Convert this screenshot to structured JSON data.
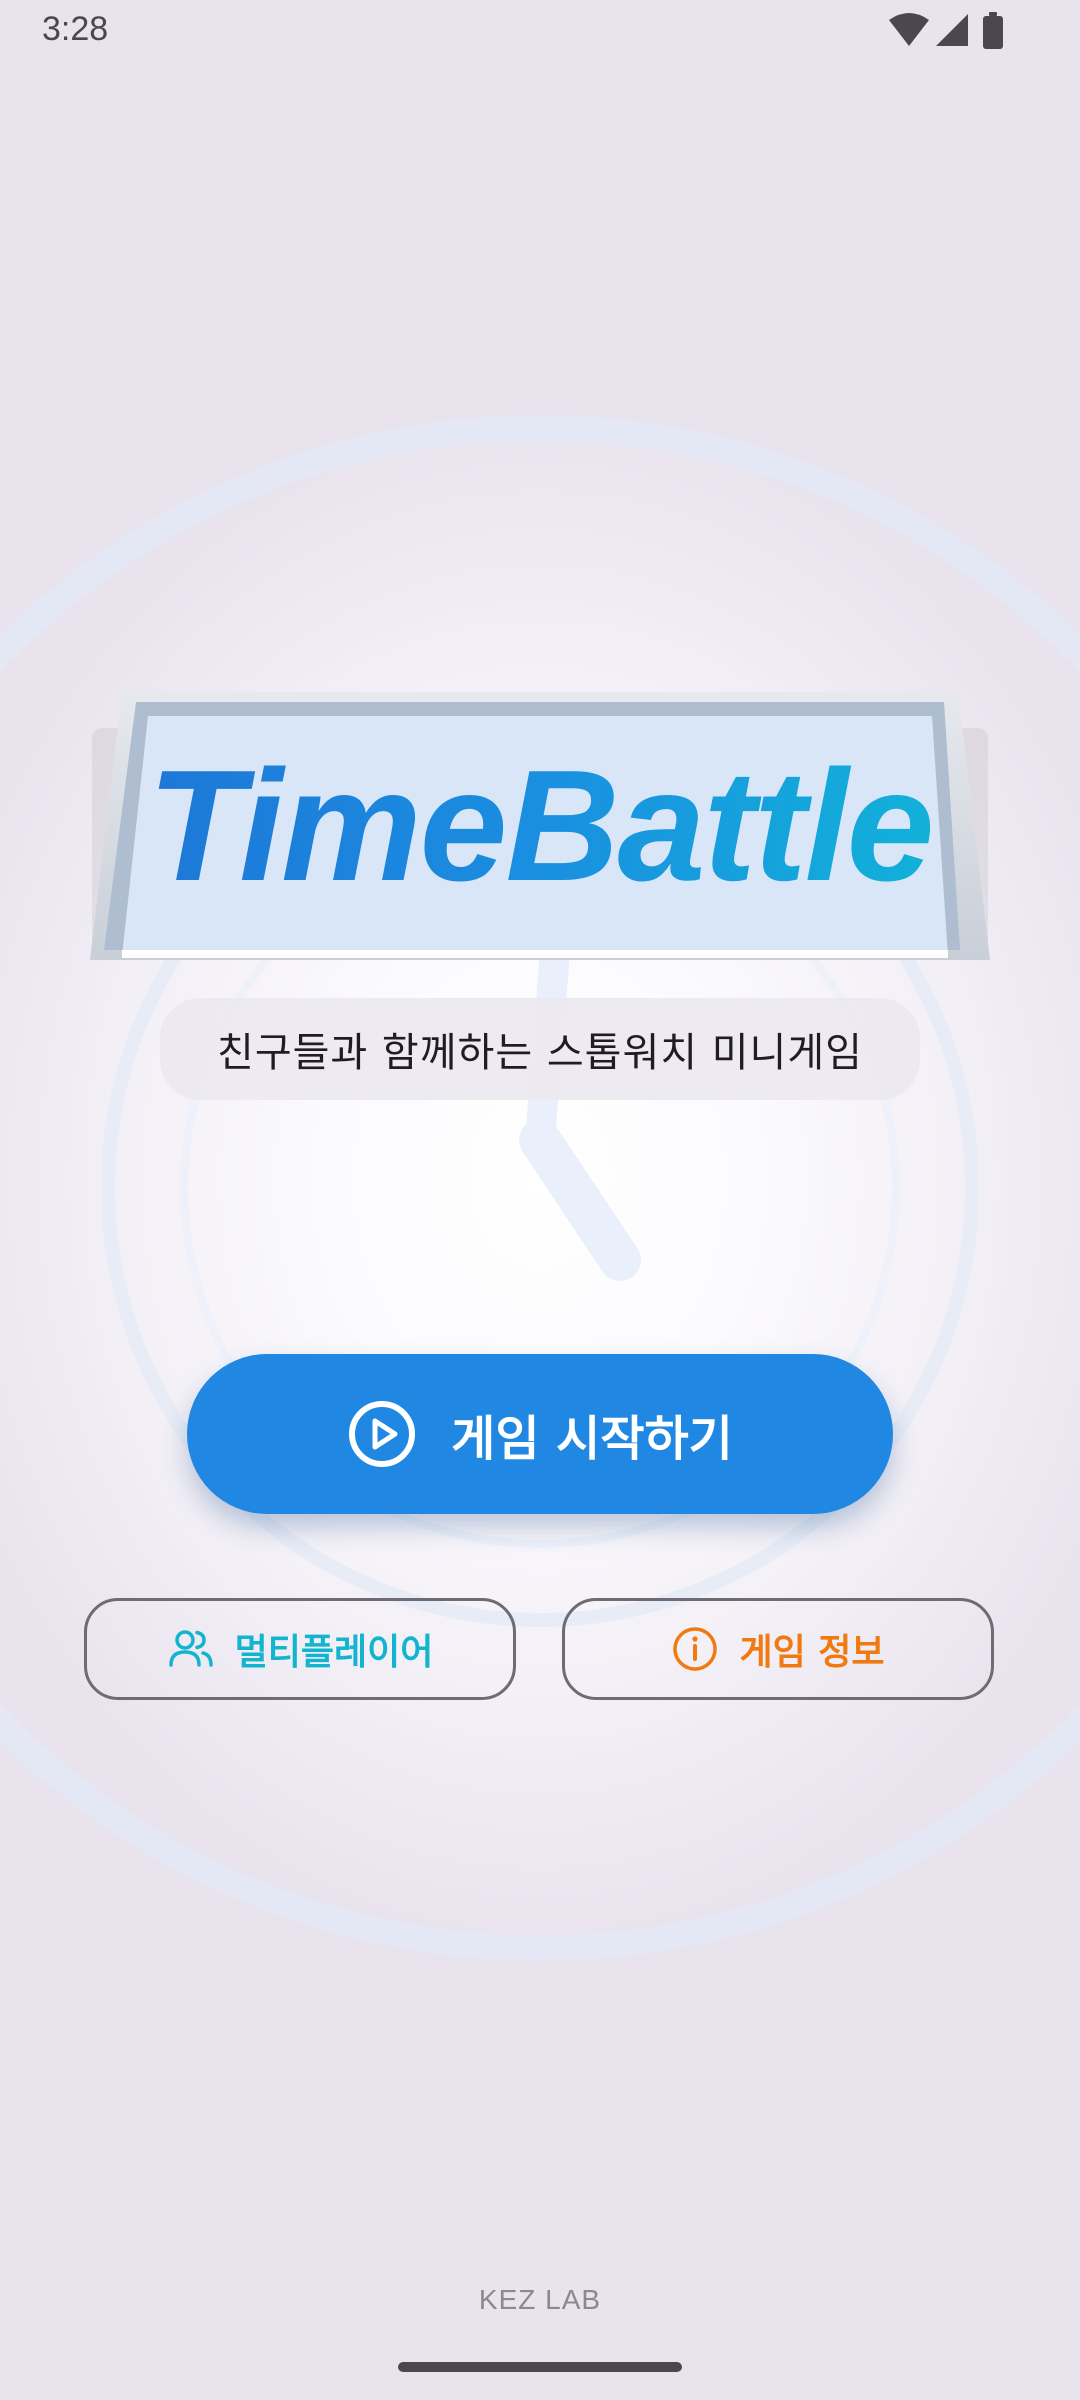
{
  "status_bar": {
    "time": "3:28",
    "icons": [
      "wifi-icon",
      "signal-icon",
      "battery-icon"
    ]
  },
  "title": {
    "text": "TimeBattle"
  },
  "subtitle": {
    "text": "친구들과 함께하는 스톱워치 미니게임"
  },
  "start_button": {
    "label": "게임 시작하기",
    "icon": "play-circle-icon"
  },
  "multiplayer_button": {
    "label": "멀티플레이어",
    "icon": "users-icon"
  },
  "info_button": {
    "label": "게임 정보",
    "icon": "info-circle-icon"
  },
  "footer": {
    "text": "KEZ LAB"
  },
  "colors": {
    "primary": "#2088e2",
    "multiplayer_accent": "#13b4cf",
    "info_accent": "#f07a10",
    "title_gradient_start": "#1e74d6",
    "title_gradient_end": "#10b6d8",
    "background": "#ece6f0"
  }
}
